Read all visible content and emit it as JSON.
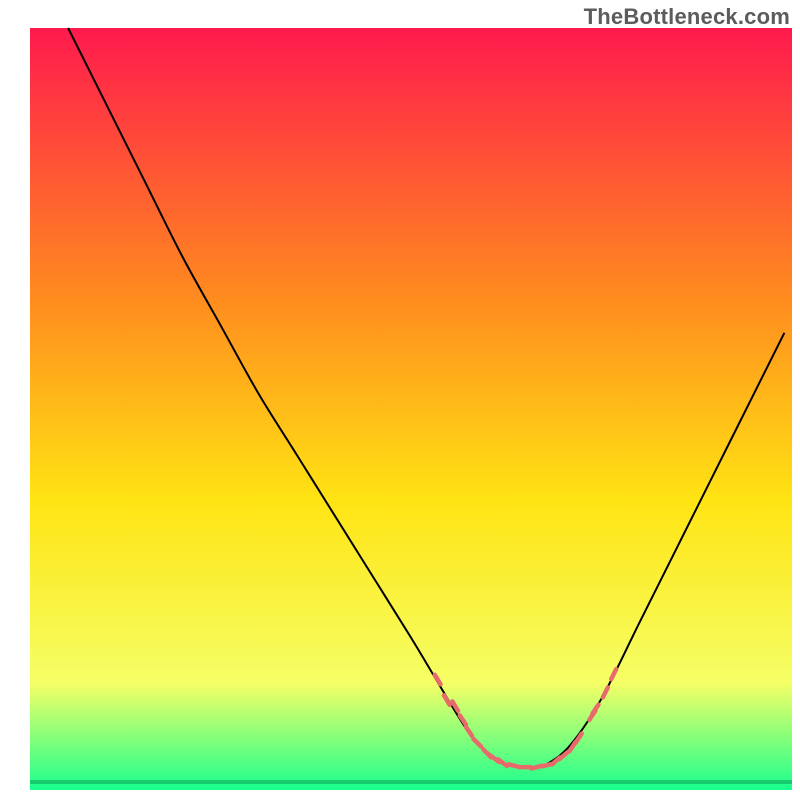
{
  "watermark": "TheBottleneck.com",
  "chart_data": {
    "type": "line",
    "title": "",
    "xlabel": "",
    "ylabel": "",
    "xlim": [
      0,
      100
    ],
    "ylim": [
      0,
      100
    ],
    "grid": false,
    "legend": false,
    "series": [
      {
        "name": "bottleneck_curve",
        "x": [
          5,
          10,
          15,
          20,
          25,
          30,
          35,
          40,
          45,
          50,
          53,
          56,
          58,
          60,
          62,
          64,
          66,
          68,
          71,
          75,
          80,
          85,
          90,
          95,
          99
        ],
        "y": [
          100,
          90,
          80,
          70,
          61,
          52,
          44,
          36,
          28,
          20,
          15,
          10,
          7,
          5,
          3.5,
          3,
          3,
          3.5,
          6,
          12,
          22,
          32,
          42,
          52,
          60
        ]
      }
    ],
    "highlight_ticks": {
      "name": "bottleneck_markers",
      "points": [
        {
          "x": 53.5,
          "y": 14.5
        },
        {
          "x": 54.7,
          "y": 11.8
        },
        {
          "x": 55.8,
          "y": 11.0
        },
        {
          "x": 56.8,
          "y": 9.2
        },
        {
          "x": 57.6,
          "y": 7.7
        },
        {
          "x": 58.7,
          "y": 6.2
        },
        {
          "x": 60.0,
          "y": 4.8
        },
        {
          "x": 61.0,
          "y": 4.1
        },
        {
          "x": 62.0,
          "y": 3.6
        },
        {
          "x": 63.5,
          "y": 3.2
        },
        {
          "x": 65.0,
          "y": 3.0
        },
        {
          "x": 66.5,
          "y": 3.0
        },
        {
          "x": 68.0,
          "y": 3.3
        },
        {
          "x": 69.0,
          "y": 3.8
        },
        {
          "x": 70.0,
          "y": 4.5
        },
        {
          "x": 71.2,
          "y": 5.7
        },
        {
          "x": 72.0,
          "y": 6.8
        },
        {
          "x": 73.8,
          "y": 9.8
        },
        {
          "x": 74.2,
          "y": 10.6
        },
        {
          "x": 75.5,
          "y": 12.8
        },
        {
          "x": 76.6,
          "y": 15.2
        }
      ]
    },
    "gradient": {
      "top_color": "#ff1a4d",
      "mid1_color": "#ff8a1f",
      "mid2_color": "#ffe413",
      "mid3_color": "#f5ff66",
      "bottom_color": "#19ff8e"
    }
  }
}
